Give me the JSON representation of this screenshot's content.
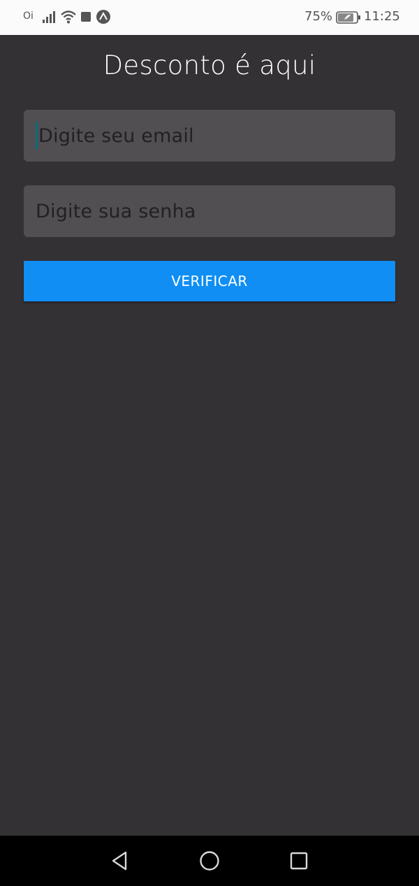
{
  "status_bar": {
    "carrier": "Oi",
    "battery_percent": "75%",
    "time": "11:25",
    "icons": [
      "signal-icon",
      "wifi-icon",
      "notification-square-icon",
      "expo-app-icon",
      "battery-icon"
    ]
  },
  "main": {
    "title": "Desconto é aqui",
    "email_field": {
      "placeholder": "Digite seu email",
      "value": ""
    },
    "password_field": {
      "placeholder": "Digite sua senha",
      "value": ""
    },
    "verify_button_label": "VERIFICAR"
  },
  "nav_bar": {
    "icons": [
      "back-icon",
      "home-icon",
      "recents-icon"
    ]
  },
  "colors": {
    "background": "#333134",
    "field_background": "#514f52",
    "button_accent": "#108ef4",
    "caret": "#0a6d78"
  }
}
